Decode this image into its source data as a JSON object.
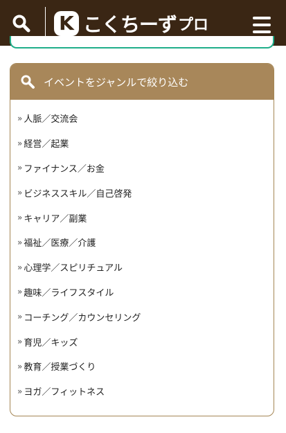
{
  "header": {
    "logo_mark": "K",
    "logo_text": "こくちーず",
    "logo_suffix": "プロ",
    "colors": {
      "background": "#3a2614",
      "foreground": "#ffffff"
    },
    "icons": {
      "search": "search-icon",
      "menu": "hamburger-menu-icon"
    }
  },
  "accent": {
    "green": "#1fae8a"
  },
  "filter": {
    "title": "イベントをジャンルで絞り込む",
    "icon": "search-icon",
    "colors": {
      "header": "#a8875a",
      "border": "#a48554"
    },
    "chevron": "»",
    "genres": [
      {
        "label": "人脈／交流会"
      },
      {
        "label": "経営／起業"
      },
      {
        "label": "ファイナンス／お金"
      },
      {
        "label": "ビジネススキル／自己啓発"
      },
      {
        "label": "キャリア／副業"
      },
      {
        "label": "福祉／医療／介護"
      },
      {
        "label": "心理学／スピリチュアル"
      },
      {
        "label": "趣味／ライフスタイル"
      },
      {
        "label": "コーチング／カウンセリング"
      },
      {
        "label": "育児／キッズ"
      },
      {
        "label": "教育／授業づくり"
      },
      {
        "label": "ヨガ／フィットネス"
      }
    ]
  }
}
